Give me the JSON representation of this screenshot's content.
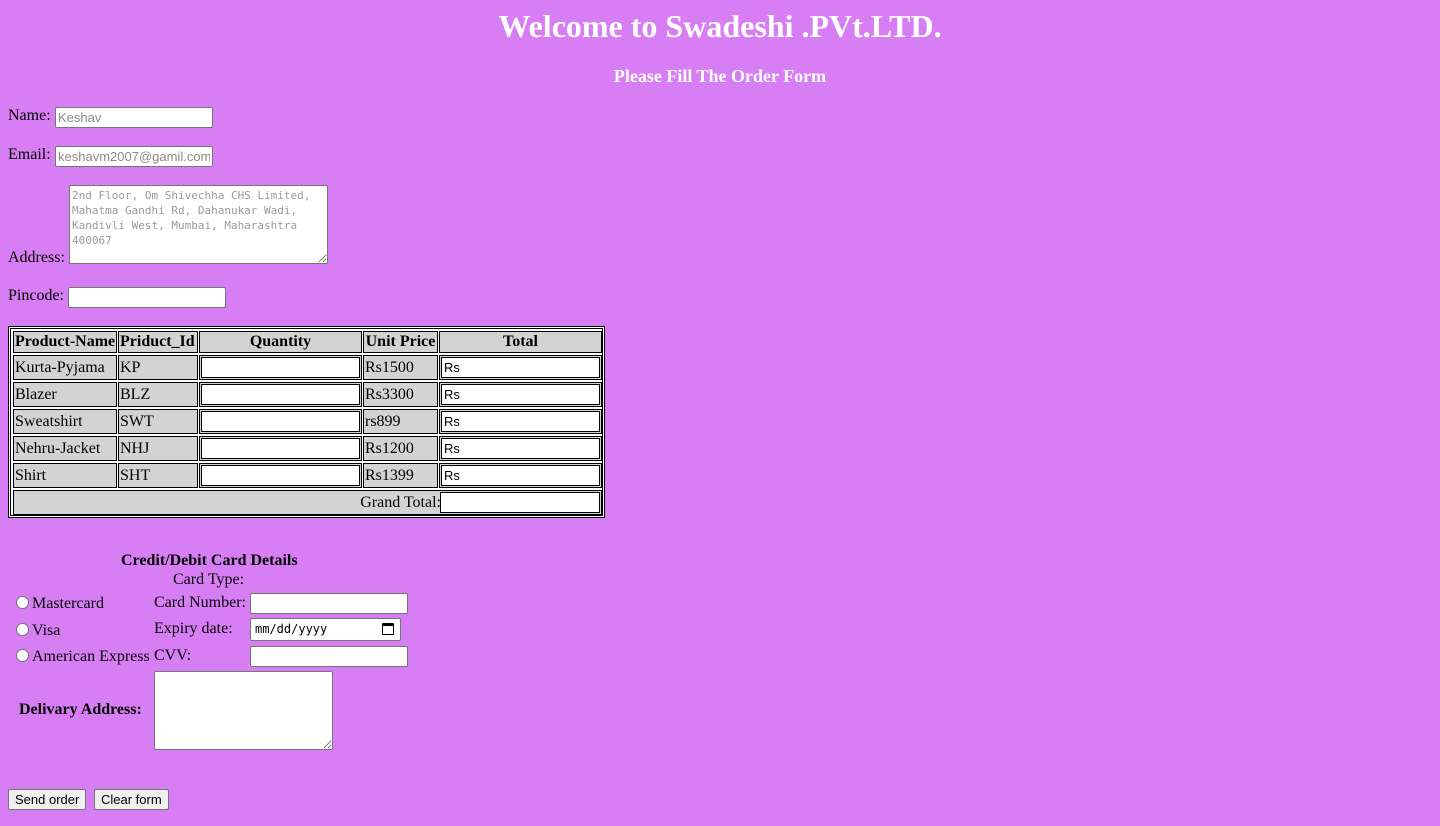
{
  "header": {
    "title": "Welcome to Swadeshi .PVt.LTD.",
    "subtitle": "Please Fill The Order Form"
  },
  "form": {
    "name_label": "Name:",
    "name_placeholder": "Keshav",
    "email_label": "Email:",
    "email_placeholder": "keshavm2007@gamil.com",
    "address_label": "Address:",
    "address_placeholder": "2nd Floor, Om Shivechha CHS Limited, Mahatma Gandhi Rd, Dahanukar Wadi, Kandivli West, Mumbai, Maharashtra 400067",
    "pincode_label": "Pincode:",
    "pincode_value": ""
  },
  "order_table": {
    "headers": [
      "Product-Name",
      "Priduct_Id",
      "Quantity",
      "Unit Price",
      "Total"
    ],
    "rows": [
      {
        "name": "Kurta-Pyjama",
        "id": "KP",
        "quantity": "",
        "price": "Rs1500",
        "total_placeholder": "Rs"
      },
      {
        "name": "Blazer",
        "id": "BLZ",
        "quantity": "",
        "price": "Rs3300",
        "total_placeholder": "Rs"
      },
      {
        "name": "Sweatshirt",
        "id": "SWT",
        "quantity": "",
        "price": "rs899",
        "total_placeholder": "Rs"
      },
      {
        "name": "Nehru-Jacket",
        "id": "NHJ",
        "quantity": "",
        "price": "Rs1200",
        "total_placeholder": "Rs"
      },
      {
        "name": "Shirt",
        "id": "SHT",
        "quantity": "",
        "price": "Rs1399",
        "total_placeholder": "Rs"
      }
    ],
    "grand_total_label": "Grand Total:",
    "grand_total_value": ""
  },
  "card": {
    "section_title": "Credit/Debit Card Details",
    "card_type_label": "Card Type:",
    "types": [
      "Mastercard",
      "Visa",
      "American Express"
    ],
    "card_number_label": "Card Number:",
    "expiry_label": "Expiry date:",
    "expiry_placeholder": "mm/dd/yyyy",
    "cvv_label": "CVV:",
    "delivery_label": "Delivary Address:"
  },
  "buttons": {
    "send": "Send order",
    "clear": "Clear form"
  }
}
